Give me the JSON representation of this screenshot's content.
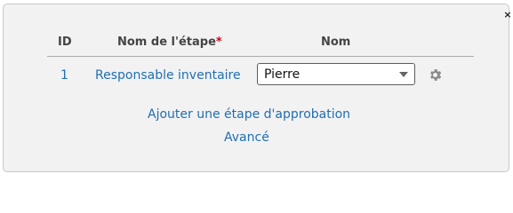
{
  "dialog": {
    "close_glyph": "×"
  },
  "table": {
    "headers": {
      "id": "ID",
      "step_name": "Nom de l'étape",
      "required_marker": "*",
      "name": "Nom"
    },
    "rows": [
      {
        "id": "1",
        "step_name": "Responsable inventaire",
        "name_select": {
          "selected": "Pierre"
        }
      }
    ]
  },
  "links": {
    "add_step": "Ajouter une étape d'approbation",
    "advanced": "Avancé"
  },
  "icons": {
    "close": "close-icon",
    "dropdown": "chevron-down-icon",
    "settings": "gear-icon"
  },
  "colors": {
    "link": "#1f6fb2",
    "required": "#d0021b",
    "panel_bg": "#f2f2f2"
  }
}
